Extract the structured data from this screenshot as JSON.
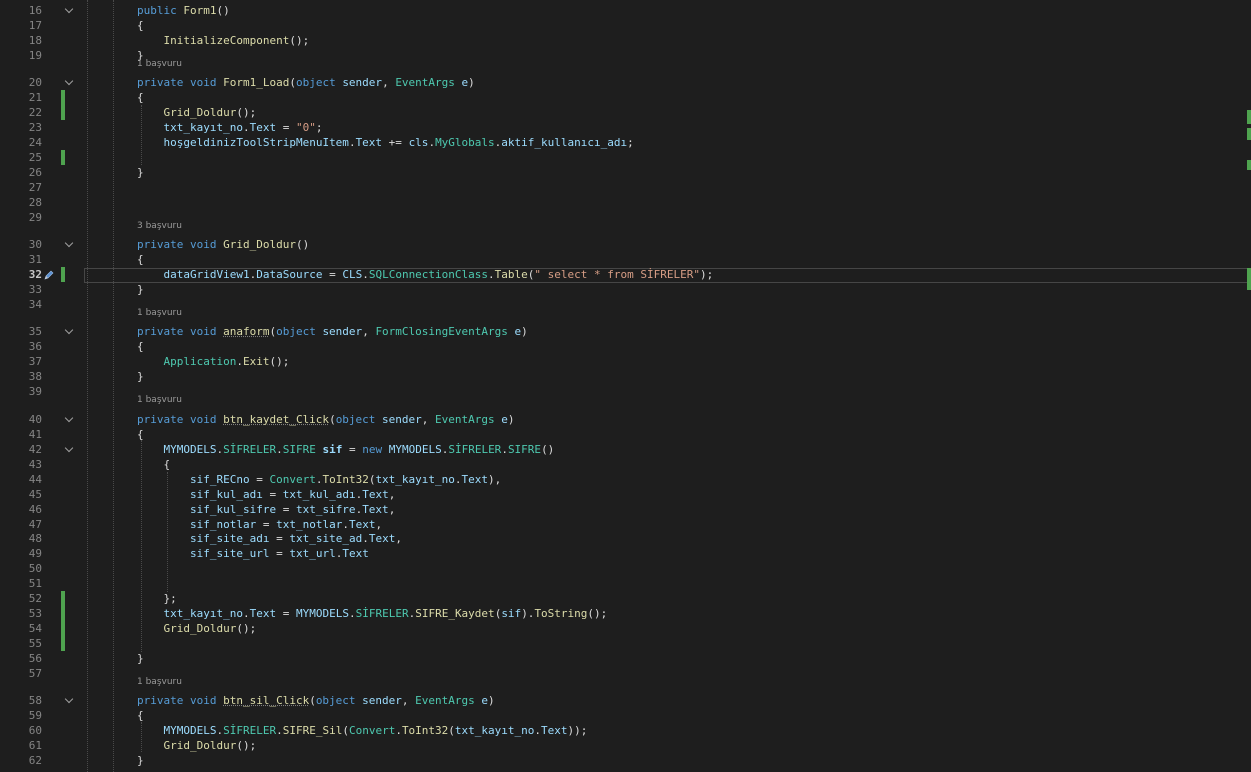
{
  "colors": {
    "background": "#1e1e1e",
    "line_number": "#858585",
    "keyword": "#569cd6",
    "type": "#4ec9b0",
    "method": "#dcdcaa",
    "string": "#d69d85",
    "variable": "#9cdcfe",
    "plain": "#dcdcdc",
    "change_bar": "#4fa34f",
    "codelens": "#999999"
  },
  "code_lines": [
    {
      "num": "16",
      "fold": true,
      "change": false,
      "lens": "",
      "tokens": [
        [
          "kw",
          "public "
        ],
        [
          "fn",
          "Form1"
        ],
        [
          "pl",
          "()"
        ]
      ]
    },
    {
      "num": "17",
      "fold": false,
      "change": false,
      "lens": "",
      "tokens": [
        [
          "pl",
          "{"
        ]
      ]
    },
    {
      "num": "18",
      "fold": false,
      "change": false,
      "lens": "",
      "tokens": [
        [
          "pl",
          "    "
        ],
        [
          "fn",
          "InitializeComponent"
        ],
        [
          "pl",
          "();"
        ]
      ]
    },
    {
      "num": "19",
      "fold": false,
      "change": false,
      "lens": "1 başvuru",
      "tokens": [
        [
          "pl",
          "}"
        ]
      ]
    },
    {
      "num": "20",
      "fold": true,
      "change": false,
      "lens": "",
      "tokens": [
        [
          "kw",
          "private void "
        ],
        [
          "fn",
          "Form1_Load"
        ],
        [
          "pl",
          "("
        ],
        [
          "kw",
          "object "
        ],
        [
          "var",
          "sender"
        ],
        [
          "pl",
          ", "
        ],
        [
          "ty",
          "EventArgs "
        ],
        [
          "var",
          "e"
        ],
        [
          "pl",
          ")"
        ]
      ]
    },
    {
      "num": "21",
      "fold": false,
      "change": true,
      "lens": "",
      "tokens": [
        [
          "pl",
          "{"
        ]
      ]
    },
    {
      "num": "22",
      "fold": false,
      "change": true,
      "lens": "",
      "tokens": [
        [
          "pl",
          "    "
        ],
        [
          "fn",
          "Grid_Doldur"
        ],
        [
          "pl",
          "();"
        ]
      ]
    },
    {
      "num": "23",
      "fold": false,
      "change": false,
      "lens": "",
      "tokens": [
        [
          "pl",
          "    "
        ],
        [
          "var",
          "txt_kayıt_no"
        ],
        [
          "pl",
          "."
        ],
        [
          "var",
          "Text"
        ],
        [
          "pl",
          " = "
        ],
        [
          "str",
          "\"0\""
        ],
        [
          "pl",
          ";"
        ]
      ]
    },
    {
      "num": "24",
      "fold": false,
      "change": false,
      "lens": "",
      "tokens": [
        [
          "pl",
          "    "
        ],
        [
          "var",
          "hoşgeldinizToolStripMenuItem"
        ],
        [
          "pl",
          "."
        ],
        [
          "var",
          "Text"
        ],
        [
          "pl",
          " += "
        ],
        [
          "var",
          "cls"
        ],
        [
          "pl",
          "."
        ],
        [
          "ty",
          "MyGlobals"
        ],
        [
          "pl",
          "."
        ],
        [
          "var",
          "aktif_kullanıcı_adı"
        ],
        [
          "pl",
          ";"
        ]
      ]
    },
    {
      "num": "25",
      "fold": false,
      "change": true,
      "lens": "",
      "tokens": []
    },
    {
      "num": "26",
      "fold": false,
      "change": false,
      "lens": "",
      "tokens": [
        [
          "pl",
          "}"
        ]
      ]
    },
    {
      "num": "27",
      "fold": false,
      "change": false,
      "lens": "",
      "tokens": []
    },
    {
      "num": "28",
      "fold": false,
      "change": false,
      "lens": "",
      "tokens": []
    },
    {
      "num": "29",
      "fold": false,
      "change": false,
      "lens": "3 başvuru",
      "tokens": []
    },
    {
      "num": "30",
      "fold": true,
      "change": false,
      "lens": "",
      "tokens": [
        [
          "kw",
          "private void "
        ],
        [
          "fn",
          "Grid_Doldur"
        ],
        [
          "pl",
          "()"
        ]
      ]
    },
    {
      "num": "31",
      "fold": false,
      "change": false,
      "lens": "",
      "tokens": [
        [
          "pl",
          "{"
        ]
      ]
    },
    {
      "num": "32",
      "fold": false,
      "change": true,
      "active": true,
      "lens": "",
      "tokens": [
        [
          "pl",
          "    "
        ],
        [
          "var",
          "dataGridView1"
        ],
        [
          "pl",
          "."
        ],
        [
          "var",
          "DataSource"
        ],
        [
          "pl",
          " = "
        ],
        [
          "var",
          "CLS"
        ],
        [
          "pl",
          "."
        ],
        [
          "ty",
          "SQLConnectionClass"
        ],
        [
          "pl",
          "."
        ],
        [
          "fn",
          "Table"
        ],
        [
          "pl",
          "("
        ],
        [
          "str",
          "\" select * from SİFRELER\""
        ],
        [
          "pl",
          ");"
        ]
      ]
    },
    {
      "num": "33",
      "fold": false,
      "change": false,
      "lens": "",
      "tokens": [
        [
          "pl",
          "}"
        ]
      ]
    },
    {
      "num": "34",
      "fold": false,
      "change": false,
      "lens": "1 başvuru",
      "tokens": []
    },
    {
      "num": "35",
      "fold": true,
      "change": false,
      "lens": "",
      "tokens": [
        [
          "kw",
          "private void "
        ],
        [
          "fn squiggle",
          "anaform"
        ],
        [
          "pl",
          "("
        ],
        [
          "kw",
          "object "
        ],
        [
          "var",
          "sender"
        ],
        [
          "pl",
          ", "
        ],
        [
          "ty",
          "FormClosingEventArgs "
        ],
        [
          "var",
          "e"
        ],
        [
          "pl",
          ")"
        ]
      ]
    },
    {
      "num": "36",
      "fold": false,
      "change": false,
      "lens": "",
      "tokens": [
        [
          "pl",
          "{"
        ]
      ]
    },
    {
      "num": "37",
      "fold": false,
      "change": false,
      "lens": "",
      "tokens": [
        [
          "pl",
          "    "
        ],
        [
          "ty",
          "Application"
        ],
        [
          "pl",
          "."
        ],
        [
          "fn",
          "Exit"
        ],
        [
          "pl",
          "();"
        ]
      ]
    },
    {
      "num": "38",
      "fold": false,
      "change": false,
      "lens": "",
      "tokens": [
        [
          "pl",
          "}"
        ]
      ]
    },
    {
      "num": "39",
      "fold": false,
      "change": false,
      "lens": "1 başvuru",
      "tokens": []
    },
    {
      "num": "40",
      "fold": true,
      "change": false,
      "lens": "",
      "tokens": [
        [
          "kw",
          "private void "
        ],
        [
          "fn squiggle",
          "btn_kaydet_Click"
        ],
        [
          "pl",
          "("
        ],
        [
          "kw",
          "object "
        ],
        [
          "var",
          "sender"
        ],
        [
          "pl",
          ", "
        ],
        [
          "ty",
          "EventArgs "
        ],
        [
          "var",
          "e"
        ],
        [
          "pl",
          ")"
        ]
      ]
    },
    {
      "num": "41",
      "fold": false,
      "change": false,
      "lens": "",
      "tokens": [
        [
          "pl",
          "{"
        ]
      ]
    },
    {
      "num": "42",
      "fold": true,
      "change": false,
      "lens": "",
      "tokens": [
        [
          "pl",
          "    "
        ],
        [
          "var",
          "MYMODELS"
        ],
        [
          "pl",
          "."
        ],
        [
          "ty",
          "SİFRELER"
        ],
        [
          "pl",
          "."
        ],
        [
          "ty",
          "SIFRE "
        ],
        [
          "var bold",
          "sif"
        ],
        [
          "pl",
          " = "
        ],
        [
          "kw",
          "new "
        ],
        [
          "var",
          "MYMODELS"
        ],
        [
          "pl",
          "."
        ],
        [
          "ty",
          "SİFRELER"
        ],
        [
          "pl",
          "."
        ],
        [
          "ty",
          "SIFRE"
        ],
        [
          "pl",
          "()"
        ]
      ]
    },
    {
      "num": "43",
      "fold": false,
      "change": false,
      "lens": "",
      "tokens": [
        [
          "pl",
          "    {"
        ]
      ]
    },
    {
      "num": "44",
      "fold": false,
      "change": false,
      "lens": "",
      "tokens": [
        [
          "pl",
          "        "
        ],
        [
          "var",
          "sif_RECno"
        ],
        [
          "pl",
          " = "
        ],
        [
          "ty",
          "Convert"
        ],
        [
          "pl",
          "."
        ],
        [
          "fn",
          "ToInt32"
        ],
        [
          "pl",
          "("
        ],
        [
          "var",
          "txt_kayıt_no"
        ],
        [
          "pl",
          "."
        ],
        [
          "var",
          "Text"
        ],
        [
          "pl",
          "),"
        ]
      ]
    },
    {
      "num": "45",
      "fold": false,
      "change": false,
      "lens": "",
      "tokens": [
        [
          "pl",
          "        "
        ],
        [
          "var",
          "sif_kul_adı"
        ],
        [
          "pl",
          " = "
        ],
        [
          "var",
          "txt_kul_adı"
        ],
        [
          "pl",
          "."
        ],
        [
          "var",
          "Text"
        ],
        [
          "pl",
          ","
        ]
      ]
    },
    {
      "num": "46",
      "fold": false,
      "change": false,
      "lens": "",
      "tokens": [
        [
          "pl",
          "        "
        ],
        [
          "var",
          "sif_kul_sifre"
        ],
        [
          "pl",
          " = "
        ],
        [
          "var",
          "txt_sifre"
        ],
        [
          "pl",
          "."
        ],
        [
          "var",
          "Text"
        ],
        [
          "pl",
          ","
        ]
      ]
    },
    {
      "num": "47",
      "fold": false,
      "change": false,
      "lens": "",
      "tokens": [
        [
          "pl",
          "        "
        ],
        [
          "var",
          "sif_notlar"
        ],
        [
          "pl",
          " = "
        ],
        [
          "var",
          "txt_notlar"
        ],
        [
          "pl",
          "."
        ],
        [
          "var",
          "Text"
        ],
        [
          "pl",
          ","
        ]
      ]
    },
    {
      "num": "48",
      "fold": false,
      "change": false,
      "lens": "",
      "tokens": [
        [
          "pl",
          "        "
        ],
        [
          "var",
          "sif_site_adı"
        ],
        [
          "pl",
          " = "
        ],
        [
          "var",
          "txt_site_ad"
        ],
        [
          "pl",
          "."
        ],
        [
          "var",
          "Text"
        ],
        [
          "pl",
          ","
        ]
      ]
    },
    {
      "num": "49",
      "fold": false,
      "change": false,
      "lens": "",
      "tokens": [
        [
          "pl",
          "        "
        ],
        [
          "var",
          "sif_site_url"
        ],
        [
          "pl",
          " = "
        ],
        [
          "var",
          "txt_url"
        ],
        [
          "pl",
          "."
        ],
        [
          "var",
          "Text"
        ]
      ]
    },
    {
      "num": "50",
      "fold": false,
      "change": false,
      "lens": "",
      "tokens": []
    },
    {
      "num": "51",
      "fold": false,
      "change": false,
      "lens": "",
      "tokens": []
    },
    {
      "num": "52",
      "fold": false,
      "change": true,
      "lens": "",
      "tokens": [
        [
          "pl",
          "    };"
        ]
      ]
    },
    {
      "num": "53",
      "fold": false,
      "change": true,
      "lens": "",
      "tokens": [
        [
          "pl",
          "    "
        ],
        [
          "var",
          "txt_kayıt_no"
        ],
        [
          "pl",
          "."
        ],
        [
          "var",
          "Text"
        ],
        [
          "pl",
          " = "
        ],
        [
          "var",
          "MYMODELS"
        ],
        [
          "pl",
          "."
        ],
        [
          "ty",
          "SİFRELER"
        ],
        [
          "pl",
          "."
        ],
        [
          "fn",
          "SIFRE_Kaydet"
        ],
        [
          "pl",
          "("
        ],
        [
          "var",
          "sif"
        ],
        [
          "pl",
          ")."
        ],
        [
          "fn",
          "ToString"
        ],
        [
          "pl",
          "();"
        ]
      ]
    },
    {
      "num": "54",
      "fold": false,
      "change": true,
      "lens": "",
      "tokens": [
        [
          "pl",
          "    "
        ],
        [
          "fn",
          "Grid_Doldur"
        ],
        [
          "pl",
          "();"
        ]
      ]
    },
    {
      "num": "55",
      "fold": false,
      "change": true,
      "lens": "",
      "tokens": []
    },
    {
      "num": "56",
      "fold": false,
      "change": false,
      "lens": "",
      "tokens": [
        [
          "pl",
          "}"
        ]
      ]
    },
    {
      "num": "57",
      "fold": false,
      "change": false,
      "lens": "1 başvuru",
      "tokens": []
    },
    {
      "num": "58",
      "fold": true,
      "change": false,
      "lens": "",
      "tokens": [
        [
          "kw",
          "private void "
        ],
        [
          "fn squiggle",
          "btn_sil_Click"
        ],
        [
          "pl",
          "("
        ],
        [
          "kw",
          "object "
        ],
        [
          "var",
          "sender"
        ],
        [
          "pl",
          ", "
        ],
        [
          "ty",
          "EventArgs "
        ],
        [
          "var",
          "e"
        ],
        [
          "pl",
          ")"
        ]
      ]
    },
    {
      "num": "59",
      "fold": false,
      "change": false,
      "lens": "",
      "tokens": [
        [
          "pl",
          "{"
        ]
      ]
    },
    {
      "num": "60",
      "fold": false,
      "change": false,
      "lens": "",
      "tokens": [
        [
          "pl",
          "    "
        ],
        [
          "var",
          "MYMODELS"
        ],
        [
          "pl",
          "."
        ],
        [
          "ty",
          "SİFRELER"
        ],
        [
          "pl",
          "."
        ],
        [
          "fn",
          "SIFRE_Sil"
        ],
        [
          "pl",
          "("
        ],
        [
          "ty",
          "Convert"
        ],
        [
          "pl",
          "."
        ],
        [
          "fn",
          "ToInt32"
        ],
        [
          "pl",
          "("
        ],
        [
          "var",
          "txt_kayıt_no"
        ],
        [
          "pl",
          "."
        ],
        [
          "var",
          "Text"
        ],
        [
          "pl",
          "));"
        ]
      ]
    },
    {
      "num": "61",
      "fold": false,
      "change": false,
      "lens": "",
      "tokens": [
        [
          "pl",
          "    "
        ],
        [
          "fn",
          "Grid_Doldur"
        ],
        [
          "pl",
          "();"
        ]
      ]
    },
    {
      "num": "62",
      "fold": false,
      "change": false,
      "lens": "",
      "tokens": [
        [
          "pl",
          "}"
        ]
      ]
    }
  ]
}
